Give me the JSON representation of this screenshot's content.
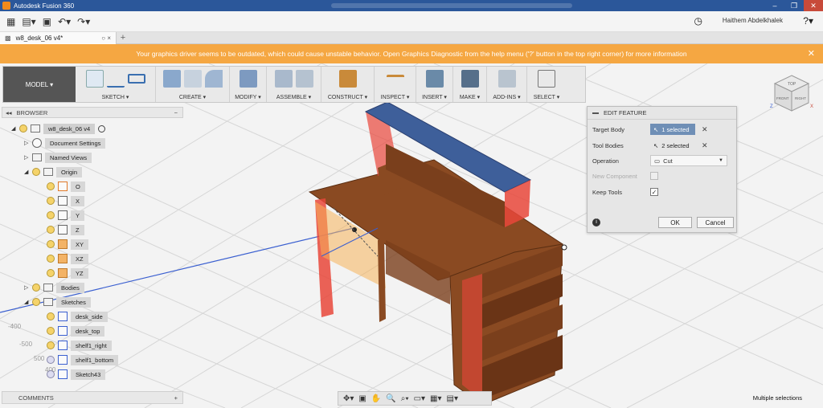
{
  "window": {
    "title": "Autodesk Fusion 360",
    "controls": [
      "‒",
      "❐",
      "✕"
    ]
  },
  "quick_access": {
    "user_name": "Haithem Abdelkhalek",
    "icons": [
      "apps-grid-icon",
      "file-icon",
      "save-icon",
      "undo-icon",
      "redo-icon"
    ],
    "clock_icon": "clock-icon",
    "help_icon": "help-icon"
  },
  "tabs": [
    {
      "label": "w8_desk_06 v4*",
      "close": "○ ×"
    }
  ],
  "tab_plus": "+",
  "warning": {
    "text": "Your graphics driver seems to be outdated, which could cause unstable behavior. Open Graphics Diagnostic from the help menu ('?' button in the top right corner) for more information",
    "close": "✕",
    "color": "#f5a742"
  },
  "toolbar": {
    "workspace": "MODEL ▾",
    "groups": [
      {
        "label": "SKETCH ▾"
      },
      {
        "label": "CREATE ▾"
      },
      {
        "label": "MODIFY ▾"
      },
      {
        "label": "ASSEMBLE ▾"
      },
      {
        "label": "CONSTRUCT ▾"
      },
      {
        "label": "INSPECT ▾"
      },
      {
        "label": "INSERT ▾"
      },
      {
        "label": "MAKE ▾"
      },
      {
        "label": "ADD-INS ▾"
      },
      {
        "label": "SELECT ▾"
      }
    ]
  },
  "browser": {
    "title": "BROWSER",
    "collapse_icon": "◂◂",
    "minimize": "−",
    "tree": [
      {
        "label": "w8_desk_06 v4",
        "level": 0,
        "arrow": "◢",
        "type": "component"
      },
      {
        "label": "Document Settings",
        "level": 1,
        "arrow": "▷",
        "type": "gear"
      },
      {
        "label": "Named Views",
        "level": 1,
        "arrow": "▷",
        "type": "folder"
      },
      {
        "label": "Origin",
        "level": 1,
        "arrow": "◢",
        "type": "folder"
      },
      {
        "label": "O",
        "level": 2,
        "arrow": "",
        "type": "point"
      },
      {
        "label": "X",
        "level": 2,
        "arrow": "",
        "type": "axis"
      },
      {
        "label": "Y",
        "level": 2,
        "arrow": "",
        "type": "axis"
      },
      {
        "label": "Z",
        "level": 2,
        "arrow": "",
        "type": "axis"
      },
      {
        "label": "XY",
        "level": 2,
        "arrow": "",
        "type": "plane"
      },
      {
        "label": "XZ",
        "level": 2,
        "arrow": "",
        "type": "plane"
      },
      {
        "label": "YZ",
        "level": 2,
        "arrow": "",
        "type": "plane"
      },
      {
        "label": "Bodies",
        "level": 1,
        "arrow": "▷",
        "type": "folder"
      },
      {
        "label": "Sketches",
        "level": 1,
        "arrow": "◢",
        "type": "folder"
      },
      {
        "label": "desk_side",
        "level": 2,
        "arrow": "",
        "type": "sketch"
      },
      {
        "label": "desk_top",
        "level": 2,
        "arrow": "",
        "type": "sketch"
      },
      {
        "label": "shelf1_right",
        "level": 2,
        "arrow": "",
        "type": "sketch"
      },
      {
        "label": "shelf1_bottom",
        "level": 2,
        "arrow": "",
        "type": "sketch"
      },
      {
        "label": "Sketch43",
        "level": 2,
        "arrow": "",
        "type": "sketch"
      }
    ]
  },
  "comments": {
    "label": "COMMENTS",
    "add": "+"
  },
  "edit_feature": {
    "title": "EDIT FEATURE",
    "rows": [
      {
        "key": "Target Body",
        "value": "1 selected",
        "kind": "selection-active",
        "clear": "✕"
      },
      {
        "key": "Tool Bodies",
        "value": "2 selected",
        "kind": "selection",
        "clear": "✕"
      },
      {
        "key": "Operation",
        "value": "Cut",
        "kind": "dropdown"
      },
      {
        "key": "New Component",
        "value": "",
        "kind": "checkbox-disabled"
      },
      {
        "key": "Keep Tools",
        "value": "✓",
        "kind": "checkbox"
      }
    ],
    "info_icon": "i",
    "ok": "OK",
    "cancel": "Cancel"
  },
  "navbar": {
    "icons": [
      "orbit-icon",
      "look-at-icon",
      "pan-icon",
      "zoom-icon",
      "fit-icon",
      "display-settings-icon",
      "grid-icon",
      "viewports-icon"
    ],
    "glyphs": [
      "✥▾",
      "▣",
      "✋",
      "🔍",
      "⌕▾",
      "▭▾",
      "▦▾",
      "▤▾"
    ]
  },
  "viewport": {
    "grid_labels": [
      "-400",
      "-500",
      "500",
      "400"
    ],
    "viewcube_faces": [
      "TOP",
      "FRONT",
      "RIGHT"
    ],
    "axis_letters": [
      "Z",
      "X"
    ]
  },
  "status": {
    "text": "Multiple selections"
  },
  "colors": {
    "titlebar": "#2b579a",
    "warning": "#f5a742",
    "selection": "#6f8fb6",
    "wood": "#8a4a22",
    "tool_body": "#e8463a",
    "top_face": "#3e5f9a"
  }
}
